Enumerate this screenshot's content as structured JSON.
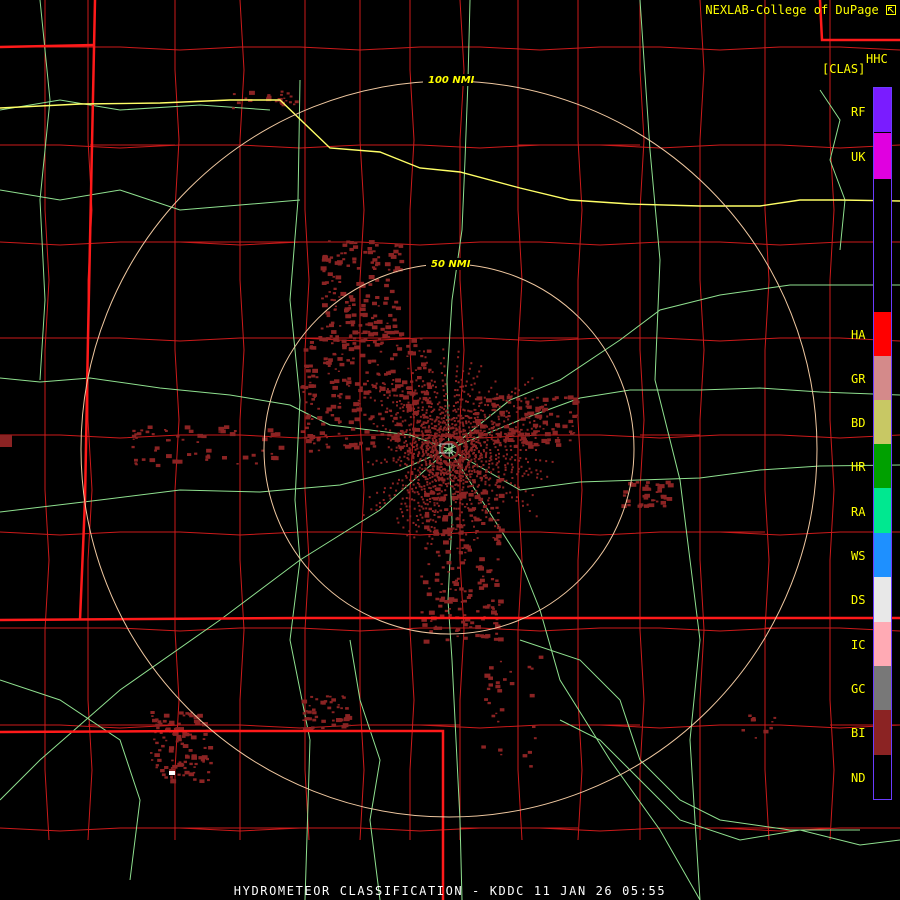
{
  "header": {
    "credit": "NEXLAB-College of DuPage",
    "credit_icon": "arrow-cursor-icon",
    "product_code": "HHC",
    "product_tag": "[CLAS]"
  },
  "rings": {
    "inner_label": "50 NMI",
    "outer_label": "100 NMI",
    "color": "#f0c8a0"
  },
  "legend": {
    "items": [
      {
        "code": "RF",
        "color": "#7a1cff"
      },
      {
        "code": "UK",
        "color": "#e000e0"
      },
      {
        "code": "HA",
        "color": "#ff0000"
      },
      {
        "code": "GR",
        "color": "#d48a8a"
      },
      {
        "code": "BD",
        "color": "#c8c864"
      },
      {
        "code": "HR",
        "color": "#00a000"
      },
      {
        "code": "RA",
        "color": "#00e890"
      },
      {
        "code": "WS",
        "color": "#1e90ff"
      },
      {
        "code": "DS",
        "color": "#e8e8e8"
      },
      {
        "code": "IC",
        "color": "#ffaab4"
      },
      {
        "code": "GC",
        "color": "#787878"
      },
      {
        "code": "BI",
        "color": "#8b2323"
      },
      {
        "code": "ND",
        "color": "#000000"
      }
    ]
  },
  "footer": {
    "title": "HYDROMETEOR CLASSIFICATION - KDDC 11 JAN 26 05:55"
  },
  "colors": {
    "state_border": "#ff1a1a",
    "county_line": "#cc1a1a",
    "road": "#8fe08f",
    "interstate": "#ffff66",
    "echo": "#8b2323"
  }
}
